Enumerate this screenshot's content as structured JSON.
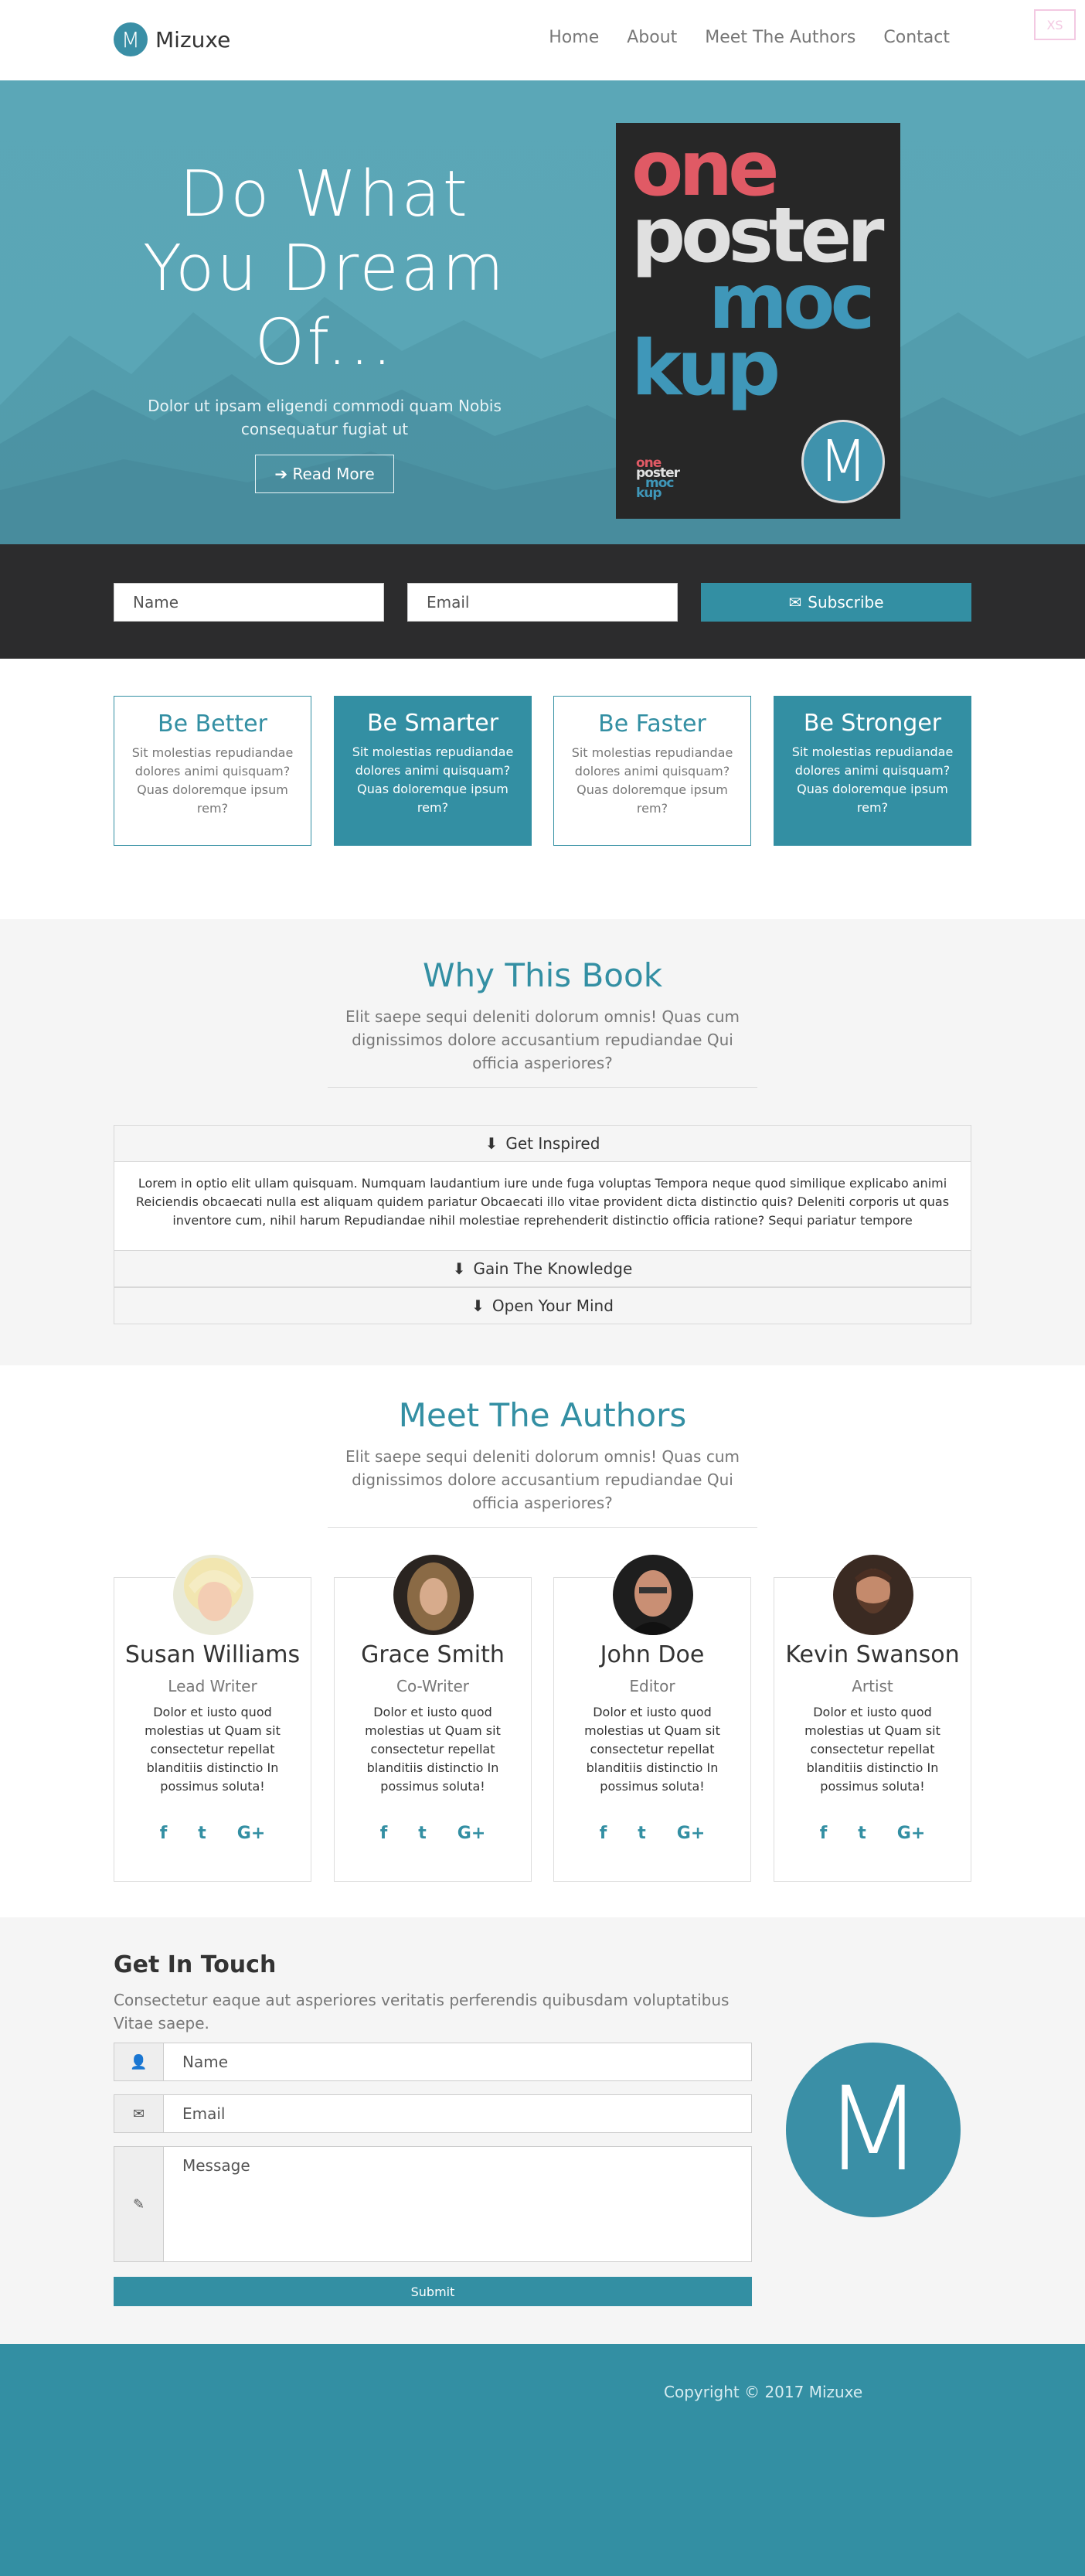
{
  "nav": {
    "brand_letter": "M",
    "brand": "Mizuxe",
    "items": [
      "Home",
      "About",
      "Meet The Authors",
      "Contact"
    ],
    "badge": "XS"
  },
  "hero": {
    "title_line1": "Do What",
    "title_line2": "You Dream",
    "title_line3": "Of...",
    "subtitle": "Dolor ut ipsam eligendi commodi quam Nobis consequatur fugiat ut",
    "button": "Read More",
    "poster_words": [
      "one",
      "poster",
      "moc",
      "kup"
    ],
    "poster_badge": "M"
  },
  "subscribe": {
    "name_placeholder": "Name",
    "email_placeholder": "Email",
    "button": "Subscribe"
  },
  "features": [
    {
      "title": "Be Better",
      "text": "Sit molestias repudiandae dolores animi quisquam? Quas doloremque ipsum rem?"
    },
    {
      "title": "Be Smarter",
      "text": "Sit molestias repudiandae dolores animi quisquam? Quas doloremque ipsum rem?"
    },
    {
      "title": "Be Faster",
      "text": "Sit molestias repudiandae dolores animi quisquam? Quas doloremque ipsum rem?"
    },
    {
      "title": "Be Stronger",
      "text": "Sit molestias repudiandae dolores animi quisquam? Quas doloremque ipsum rem?"
    }
  ],
  "why": {
    "title": "Why This Book",
    "subtitle": "Elit saepe sequi deleniti dolorum omnis! Quas cum dignissimos dolore accusantium repudiandae Qui officia asperiores?",
    "accordion": [
      {
        "label": "Get Inspired",
        "body": "Lorem in optio elit ullam quisquam. Numquam laudantium iure unde fuga voluptas Tempora neque quod similique explicabo animi Reiciendis obcaecati nulla est aliquam quidem pariatur Obcaecati illo vitae provident dicta distinctio quis? Deleniti corporis ut quas inventore cum, nihil harum Repudiandae nihil molestiae reprehenderit distinctio officia ratione? Sequi pariatur tempore"
      },
      {
        "label": "Gain The Knowledge"
      },
      {
        "label": "Open Your Mind"
      }
    ]
  },
  "authors": {
    "title": "Meet The Authors",
    "subtitle": "Elit saepe sequi deleniti dolorum omnis! Quas cum dignissimos dolore accusantium repudiandae Qui officia asperiores?",
    "list": [
      {
        "name": "Susan Williams",
        "role": "Lead Writer",
        "bio": "Dolor et iusto quod molestias ut Quam sit consectetur repellat blanditiis distinctio In possimus soluta!"
      },
      {
        "name": "Grace Smith",
        "role": "Co-Writer",
        "bio": "Dolor et iusto quod molestias ut Quam sit consectetur repellat blanditiis distinctio In possimus soluta!"
      },
      {
        "name": "John Doe",
        "role": "Editor",
        "bio": "Dolor et iusto quod molestias ut Quam sit consectetur repellat blanditiis distinctio In possimus soluta!"
      },
      {
        "name": "Kevin Swanson",
        "role": "Artist",
        "bio": "Dolor et iusto quod molestias ut Quam sit consectetur repellat blanditiis distinctio In possimus soluta!"
      }
    ],
    "social": {
      "facebook": "f",
      "twitter": "t",
      "google": "G+"
    }
  },
  "contact": {
    "title": "Get In Touch",
    "subtitle": "Consectetur eaque aut asperiores veritatis perferendis quibusdam voluptatibus Vitae saepe.",
    "name_placeholder": "Name",
    "email_placeholder": "Email",
    "message_placeholder": "Message",
    "submit": "Submit",
    "logo_letter": "M"
  },
  "footer": {
    "copyright": "Copyright © 2017 Mizuxe"
  },
  "colors": {
    "accent": "#338fa3",
    "hero": "#5aa5b5",
    "dark_bar": "#2c2c2d",
    "section_bg": "#f5f5f5"
  }
}
